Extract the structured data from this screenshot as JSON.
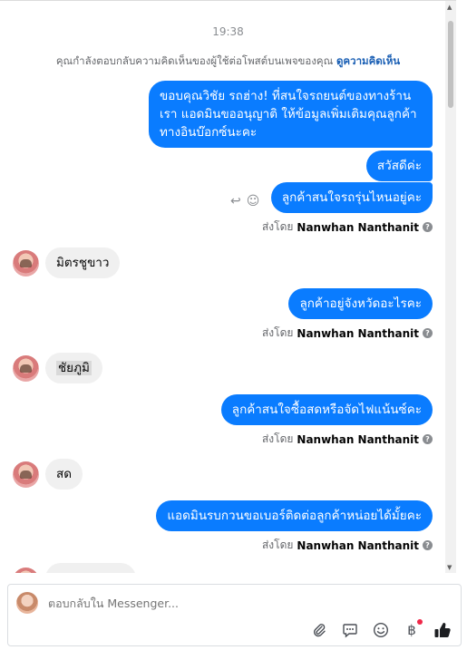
{
  "chat": {
    "time": "19:38",
    "notice_text": "คุณกำลังตอบกลับความคิดเห็นของผู้ใช้ต่อโพสต์บนเพจของคุณ",
    "notice_link": "ดูความคิดเห็น",
    "messages_out": [
      "ขอบคุณวิชัย รถฮ่าง! ที่สนใจรถยนต์ของทางร้านเรา แอดมินขออนุญาติ ให้ข้อมูลเพิ่มเติมคุณลูกค้า ทางอินบ๊อกซ์นะคะ",
      "สวัสดีค่ะ",
      "ลูกค้าสนใจรถรุ่นไหนอยู่คะ",
      "ลูกค้าอยู่จังหวัดอะไรคะ",
      "ลูกค้าสนใจซื้อสดหรือจัดไฟแน้นซ์คะ",
      "แอดมินรบกวนขอเบอร์ติดต่อลูกค้าหน่อยได้มั้ยคะ"
    ],
    "messages_in": [
      "มิตรชูขาว",
      "ชัยภูมิ",
      "สด"
    ],
    "sent_by_prefix": "ส่งโดย",
    "sent_by_name": "Nanwhan Nanthanit"
  },
  "composer": {
    "placeholder": "ตอบกลับใน Messenger..."
  }
}
